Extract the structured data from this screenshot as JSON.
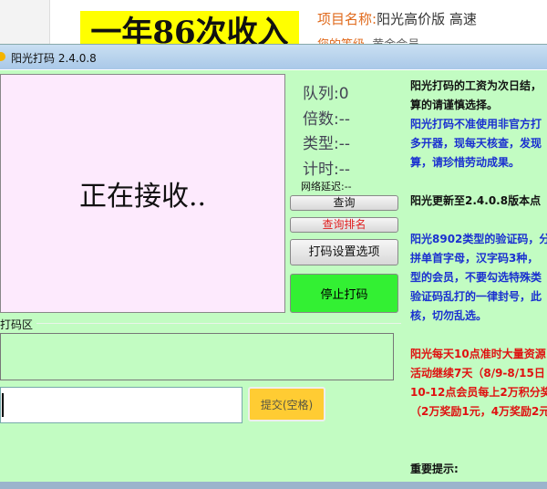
{
  "background_page": {
    "banner": "一年86次收入",
    "project_label": "项目名称:",
    "project_value": "阳光高价版 高速",
    "level_label": "您的等级",
    "level_value": "黄金会员"
  },
  "window": {
    "title": "阳光打码 2.4.0.8"
  },
  "captcha_area": {
    "status": "正在接收.."
  },
  "stats": {
    "queue": "队列:0",
    "multiplier": "倍数:--",
    "type": "类型:--",
    "timer": "计时:--",
    "latency": "网络延迟:--"
  },
  "buttons": {
    "query": "查询",
    "query_rank": "查询排名",
    "settings": "打码设置选项",
    "stop": "停止打码",
    "submit": "提交(空格)"
  },
  "code_area": {
    "label": "打码区",
    "input_value": ""
  },
  "notice": [
    {
      "color": "black",
      "text": "阳光打码的工资为次日结，"
    },
    {
      "color": "black",
      "text": "算的请谨慎选择。"
    },
    {
      "color": "blue",
      "text": "阳光打码不准使用非官方打"
    },
    {
      "color": "blue",
      "text": "多开器，现每天核查，发现"
    },
    {
      "color": "blue",
      "text": "算，请珍惜劳动成果。"
    },
    {
      "color": "blank",
      "text": ""
    },
    {
      "color": "black",
      "text": "阳光更新至2.4.0.8版本点"
    },
    {
      "color": "blank",
      "text": ""
    },
    {
      "color": "blue",
      "text": "阳光8902类型的验证码，分"
    },
    {
      "color": "blue",
      "text": "拼单首字母，汉字码3种，"
    },
    {
      "color": "blue",
      "text": "型的会员，不要勾选特殊类"
    },
    {
      "color": "blue",
      "text": "验证码乱打的一律封号，此"
    },
    {
      "color": "blue",
      "text": "核，切勿乱选。"
    },
    {
      "color": "blank",
      "text": ""
    },
    {
      "color": "red",
      "text": "阳光每天10点准时大量资源"
    },
    {
      "color": "red",
      "text": "活动继续7天（8/9-8/15日"
    },
    {
      "color": "red",
      "text": "10-12点会员每上2万积分奖"
    },
    {
      "color": "red",
      "text": "（2万奖励1元，4万奖励2元"
    },
    {
      "color": "blank",
      "text": ""
    },
    {
      "color": "blank",
      "text": ""
    },
    {
      "color": "black",
      "text": "重要提示:"
    }
  ],
  "colors": {
    "window_bg": "#c2fcc2",
    "captcha_bg": "#fdeafd",
    "stop_button": "#33f033",
    "submit_button": "#ffcc33"
  }
}
